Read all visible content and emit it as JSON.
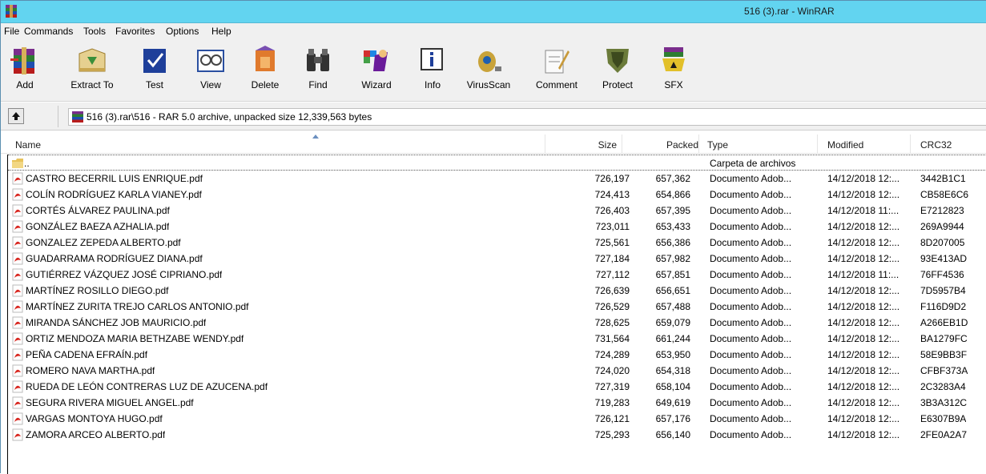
{
  "window": {
    "title": "516 (3).rar - WinRAR"
  },
  "menu": [
    "File",
    "Commands",
    "Tools",
    "Favorites",
    "Options",
    "Help"
  ],
  "toolbar": [
    {
      "label": "Add",
      "icon": "add-archive-icon"
    },
    {
      "label": "Extract To",
      "icon": "extract-icon"
    },
    {
      "label": "Test",
      "icon": "test-icon"
    },
    {
      "label": "View",
      "icon": "view-icon"
    },
    {
      "label": "Delete",
      "icon": "delete-icon"
    },
    {
      "label": "Find",
      "icon": "find-binoculars-icon"
    },
    {
      "label": "Wizard",
      "icon": "wizard-icon"
    },
    {
      "label": "Info",
      "icon": "info-icon"
    },
    {
      "label": "VirusScan",
      "icon": "virusscan-icon"
    },
    {
      "label": "Comment",
      "icon": "comment-icon"
    },
    {
      "label": "Protect",
      "icon": "protect-shield-icon"
    },
    {
      "label": "SFX",
      "icon": "sfx-icon"
    }
  ],
  "address": {
    "path": "516 (3).rar\\516 - RAR 5.0 archive, unpacked size 12,339,563 bytes"
  },
  "columns": {
    "name": "Name",
    "size": "Size",
    "packed": "Packed",
    "type": "Type",
    "modified": "Modified",
    "crc": "CRC32"
  },
  "parent_row": {
    "name": "..",
    "type": "Carpeta de archivos"
  },
  "files": [
    {
      "name": "CASTRO BECERRIL LUIS ENRIQUE.pdf",
      "size": "726,197",
      "packed": "657,362",
      "type": "Documento Adob...",
      "modified": "14/12/2018 12:...",
      "crc": "3442B1C1"
    },
    {
      "name": "COLÍN RODRÍGUEZ KARLA VIANEY.pdf",
      "size": "724,413",
      "packed": "654,866",
      "type": "Documento Adob...",
      "modified": "14/12/2018 12:...",
      "crc": "CB58E6C6"
    },
    {
      "name": "CORTÉS ÁLVAREZ PAULINA.pdf",
      "size": "726,403",
      "packed": "657,395",
      "type": "Documento Adob...",
      "modified": "14/12/2018 11:...",
      "crc": "E7212823"
    },
    {
      "name": "GONZÁLEZ BAEZA AZHALIA.pdf",
      "size": "723,011",
      "packed": "653,433",
      "type": "Documento Adob...",
      "modified": "14/12/2018 12:...",
      "crc": "269A9944"
    },
    {
      "name": "GONZALEZ ZEPEDA ALBERTO.pdf",
      "size": "725,561",
      "packed": "656,386",
      "type": "Documento Adob...",
      "modified": "14/12/2018 12:...",
      "crc": "8D207005"
    },
    {
      "name": "GUADARRAMA RODRÍGUEZ DIANA.pdf",
      "size": "727,184",
      "packed": "657,982",
      "type": "Documento Adob...",
      "modified": "14/12/2018 12:...",
      "crc": "93E413AD"
    },
    {
      "name": "GUTIÉRREZ VÁZQUEZ JOSÉ CIPRIANO.pdf",
      "size": "727,112",
      "packed": "657,851",
      "type": "Documento Adob...",
      "modified": "14/12/2018 11:...",
      "crc": "76FF4536"
    },
    {
      "name": "MARTÍNEZ ROSILLO DIEGO.pdf",
      "size": "726,639",
      "packed": "656,651",
      "type": "Documento Adob...",
      "modified": "14/12/2018 12:...",
      "crc": "7D5957B4"
    },
    {
      "name": "MARTÍNEZ ZURITA TREJO CARLOS ANTONIO.pdf",
      "size": "726,529",
      "packed": "657,488",
      "type": "Documento Adob...",
      "modified": "14/12/2018 12:...",
      "crc": "F116D9D2"
    },
    {
      "name": "MIRANDA SÁNCHEZ JOB MAURICIO.pdf",
      "size": "728,625",
      "packed": "659,079",
      "type": "Documento Adob...",
      "modified": "14/12/2018 12:...",
      "crc": "A266EB1D"
    },
    {
      "name": "ORTIZ MENDOZA MARIA BETHZABE WENDY.pdf",
      "size": "731,564",
      "packed": "661,244",
      "type": "Documento Adob...",
      "modified": "14/12/2018 12:...",
      "crc": "BA1279FC"
    },
    {
      "name": "PEÑA CADENA EFRAÍN.pdf",
      "size": "724,289",
      "packed": "653,950",
      "type": "Documento Adob...",
      "modified": "14/12/2018 12:...",
      "crc": "58E9BB3F"
    },
    {
      "name": "ROMERO NAVA MARTHA.pdf",
      "size": "724,020",
      "packed": "654,318",
      "type": "Documento Adob...",
      "modified": "14/12/2018 12:...",
      "crc": "CFBF373A"
    },
    {
      "name": "RUEDA DE LEÓN CONTRERAS LUZ DE AZUCENA.pdf",
      "size": "727,319",
      "packed": "658,104",
      "type": "Documento Adob...",
      "modified": "14/12/2018 12:...",
      "crc": "2C3283A4"
    },
    {
      "name": "SEGURA RIVERA MIGUEL ANGEL.pdf",
      "size": "719,283",
      "packed": "649,619",
      "type": "Documento Adob...",
      "modified": "14/12/2018 12:...",
      "crc": "3B3A312C"
    },
    {
      "name": "VARGAS MONTOYA HUGO.pdf",
      "size": "726,121",
      "packed": "657,176",
      "type": "Documento Adob...",
      "modified": "14/12/2018 12:...",
      "crc": "E6307B9A"
    },
    {
      "name": "ZAMORA ARCEO ALBERTO.pdf",
      "size": "725,293",
      "packed": "656,140",
      "type": "Documento Adob...",
      "modified": "14/12/2018 12:...",
      "crc": "2FE0A2A7"
    }
  ],
  "colors": {
    "titlebar": "#62d4f0",
    "pdf_icon": "#d8261f",
    "folder": "#e8c35a"
  }
}
